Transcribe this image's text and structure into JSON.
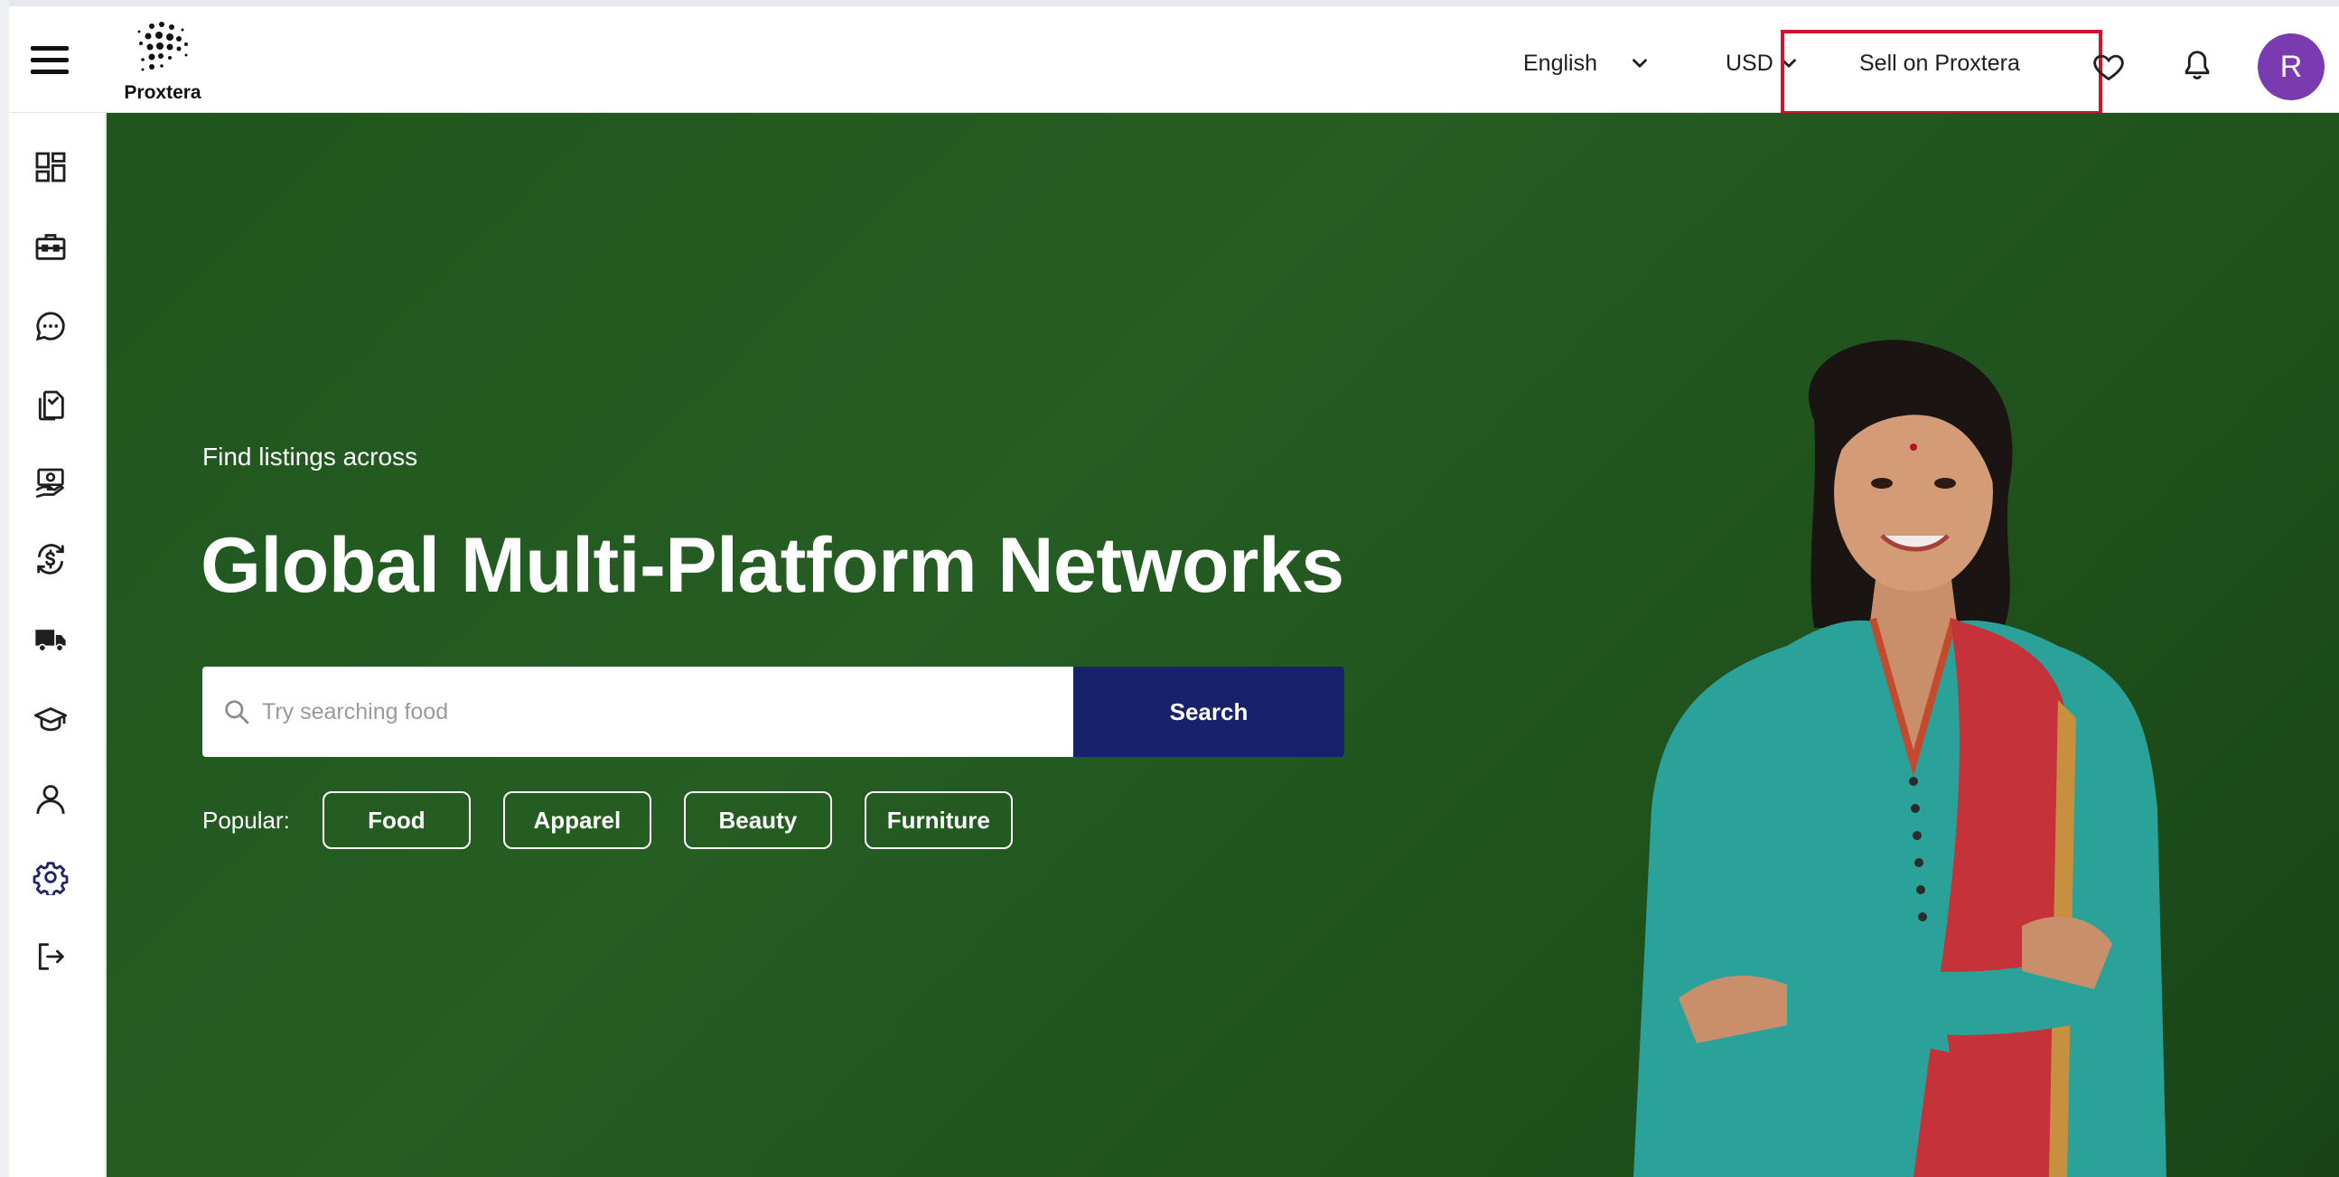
{
  "header": {
    "logo_text": "Proxtera",
    "language": "English",
    "currency": "USD",
    "sell_label": "Sell on Proxtera",
    "avatar_initial": "R"
  },
  "sidebar": {
    "items": [
      {
        "icon": "dashboard-icon"
      },
      {
        "icon": "briefcase-icon"
      },
      {
        "icon": "chat-icon"
      },
      {
        "icon": "documents-icon"
      },
      {
        "icon": "payment-icon"
      },
      {
        "icon": "currency-exchange-icon"
      },
      {
        "icon": "truck-icon"
      },
      {
        "icon": "graduation-cap-icon"
      },
      {
        "icon": "user-icon"
      },
      {
        "icon": "settings-icon"
      },
      {
        "icon": "logout-icon"
      }
    ]
  },
  "hero": {
    "subtitle": "Find listings across",
    "title": "Global Multi-Platform Networks",
    "search_placeholder": "Try searching food",
    "search_button": "Search",
    "popular_label": "Popular:",
    "tags": [
      "Food",
      "Apparel",
      "Beauty",
      "Furniture"
    ]
  },
  "colors": {
    "hero_green": "#245a21",
    "search_button": "#18216b",
    "avatar": "#7b3bb0",
    "highlight": "#d0122c"
  }
}
